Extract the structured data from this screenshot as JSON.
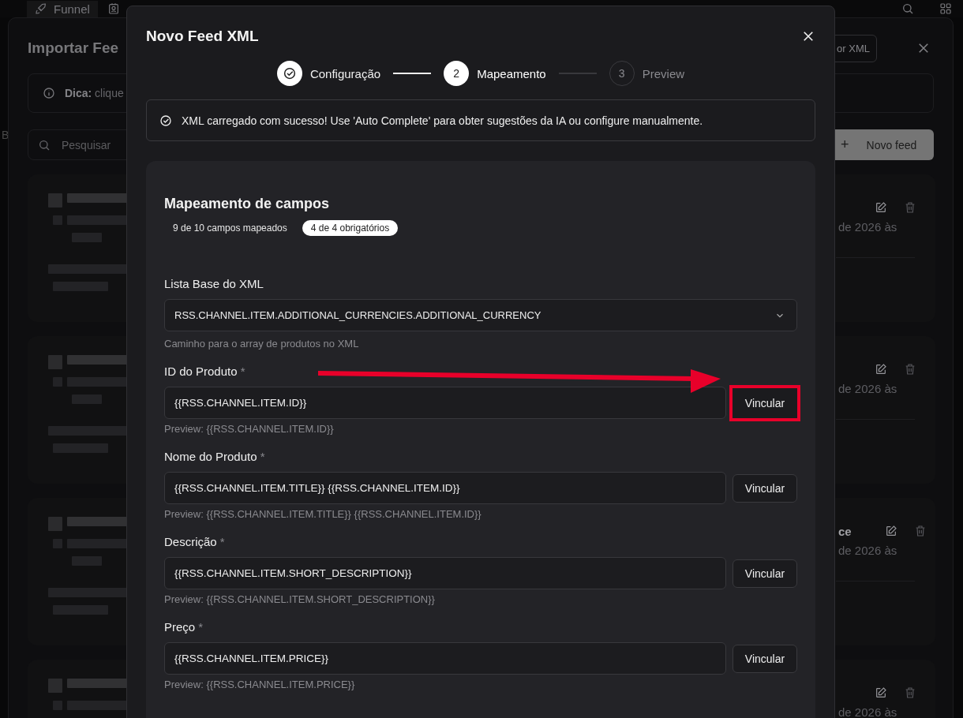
{
  "nav": {
    "tabs": [
      {
        "label": "Funnel"
      }
    ]
  },
  "background_panel": {
    "title": "Importar Fee",
    "tip": "**Dica:** clique",
    "import_button": "or XML",
    "side_letter": "B",
    "search": {
      "placeholder": "Pesquisar"
    },
    "new_button": {
      "icon": "+",
      "label": "Novo feed"
    },
    "feeds": [
      {
        "date_fragment": "de 2026 às"
      },
      {
        "date_fragment": "de 2026 às"
      },
      {
        "title_fragment": "ce",
        "date_fragment": "de 2026 às"
      },
      {
        "date_fragment": "de 2026 às"
      }
    ]
  },
  "modal": {
    "title": "Novo Feed XML",
    "steps": [
      {
        "label": "Configuração",
        "completed": true,
        "selected": false
      },
      {
        "number": "2",
        "label": "Mapeamento",
        "completed": false,
        "selected": true
      },
      {
        "number": "3",
        "label": "Preview",
        "completed": false,
        "selected": false
      }
    ],
    "alert": "XML carregado com sucesso! Use 'Auto Complete' para obter sugestões da IA ou configure manualmente.",
    "mapping": {
      "title": "Mapeamento de campos",
      "badges": [
        {
          "label": "9 de 10 campos mapeados",
          "highlighted": false
        },
        {
          "label": "4 de 4 obrigatórios",
          "highlighted": true
        }
      ],
      "base_list": {
        "label": "Lista Base do XML",
        "value": "RSS.CHANNEL.ITEM.ADDITIONAL_CURRENCIES.ADDITIONAL_CURRENCY",
        "hint": "Caminho para o array de produtos no XML"
      },
      "fields": [
        {
          "label": "ID do Produto",
          "mark": "*",
          "value": "{{RSS.CHANNEL.ITEM.ID}}",
          "button": "Vincular",
          "preview": "Preview: {{RSS.CHANNEL.ITEM.ID}}",
          "annotated": true
        },
        {
          "label": "Nome do Produto",
          "mark": "*",
          "value": "{{RSS.CHANNEL.ITEM.TITLE}} {{RSS.CHANNEL.ITEM.ID}}",
          "button": "Vincular",
          "preview": "Preview: {{RSS.CHANNEL.ITEM.TITLE}} {{RSS.CHANNEL.ITEM.ID}}",
          "annotated": false
        },
        {
          "label": "Descrição",
          "mark": "*",
          "value": "{{RSS.CHANNEL.ITEM.SHORT_DESCRIPTION}}",
          "button": "Vincular",
          "preview": "Preview: {{RSS.CHANNEL.ITEM.SHORT_DESCRIPTION}}",
          "annotated": false
        },
        {
          "label": "Preço",
          "mark": "*",
          "value": "{{RSS.CHANNEL.ITEM.PRICE}}",
          "button": "Vincular",
          "preview": "Preview: {{RSS.CHANNEL.ITEM.PRICE}}",
          "annotated": false
        }
      ]
    }
  }
}
